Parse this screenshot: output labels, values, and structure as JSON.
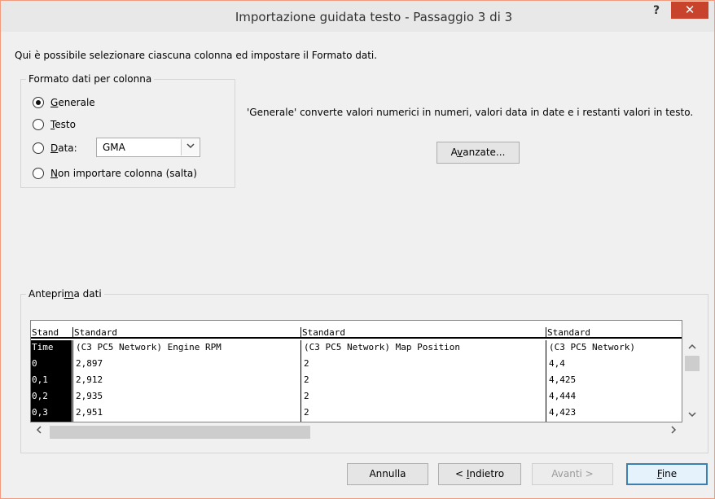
{
  "window": {
    "title": "Importazione guidata testo - Passaggio 3 di 3",
    "help_label": "?",
    "close_label": "✕"
  },
  "intro": "Qui è possibile selezionare ciascuna colonna ed impostare il Formato dati.",
  "format_group": {
    "legend": "Formato dati per colonna",
    "options": [
      {
        "mnemonic": "G",
        "rest": "enerale",
        "checked": true
      },
      {
        "mnemonic": "T",
        "rest": "esto",
        "checked": false
      },
      {
        "mnemonic": "D",
        "rest": "ata:",
        "checked": false
      },
      {
        "mnemonic": "N",
        "rest": "on importare colonna (salta)",
        "checked": false
      }
    ],
    "date_format": "GMA",
    "dropdown_icon": "chevron-down"
  },
  "description": "'Generale' converte valori numerici in numeri, valori data in date e i restanti valori in testo.",
  "advanced_button": {
    "pre": "A",
    "mnemonic": "v",
    "post": "anzate..."
  },
  "preview": {
    "legend_pre": "Antepri",
    "legend_mnemonic": "m",
    "legend_post": "a dati",
    "headers": [
      "Stand",
      "Standard",
      "Standard",
      "Standard"
    ],
    "rows": [
      [
        "Time",
        "(C3 PC5 Network) Engine RPM",
        "(C3 PC5 Network) Map Position",
        "(C3 PC5 Network)"
      ],
      [
        "0",
        "2,897",
        "2",
        "4,4"
      ],
      [
        "0,1",
        "2,912",
        "2",
        "4,425"
      ],
      [
        "0,2",
        "2,935",
        "2",
        "4,444"
      ],
      [
        "0,3",
        "2,951",
        "2",
        "4,423"
      ]
    ]
  },
  "scroll_icons": {
    "up": "▲",
    "down": "▼",
    "left": "❮",
    "right": "❯"
  },
  "buttons": {
    "cancel": "Annulla",
    "back_pre": "< ",
    "back_mnemonic": "I",
    "back_post": "ndietro",
    "next": "Avanti >",
    "finish_mnemonic": "F",
    "finish_post": "ine"
  },
  "colors": {
    "close_button": "#c7432b",
    "dialog_background": "#f0f0f0",
    "default_button_border": "#3c7fb1"
  }
}
